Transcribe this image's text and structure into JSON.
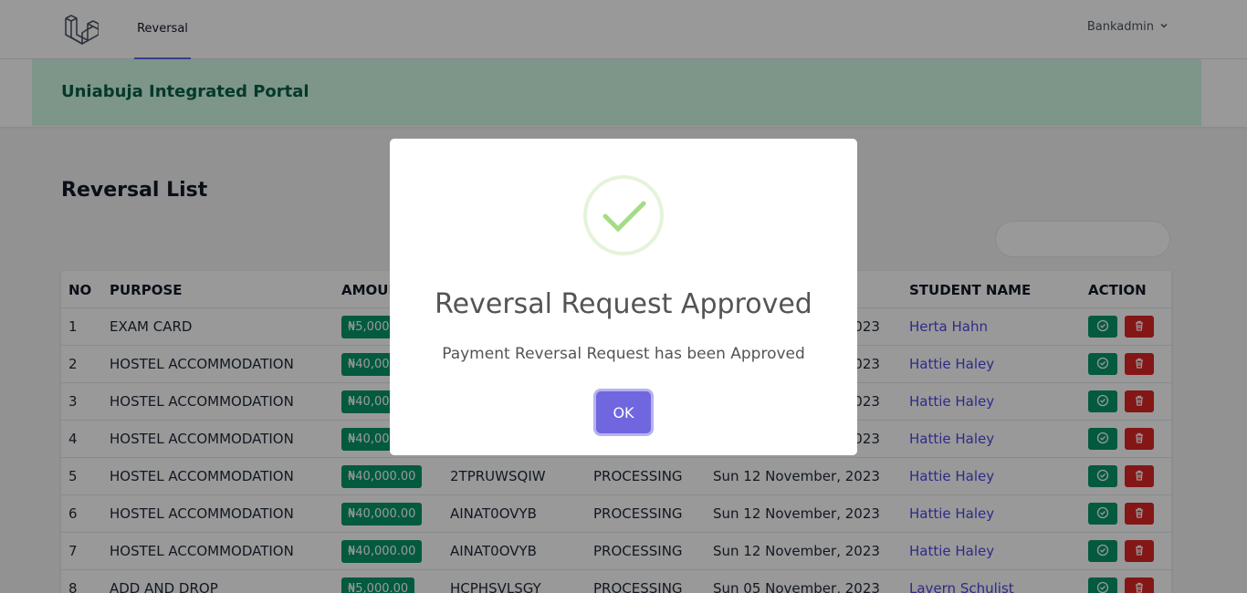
{
  "nav": {
    "link": "Reversal",
    "user": "Bankadmin"
  },
  "header": {
    "title": "Uniabuja Integrated Portal"
  },
  "page": {
    "title": "Reversal List"
  },
  "table": {
    "columns": [
      "NO",
      "PURPOSE",
      "AMOUNT",
      "",
      "",
      "",
      "STUDENT NAME",
      "ACTION"
    ],
    "rows": [
      {
        "no": "1",
        "purpose": "EXAM CARD",
        "amount": "₦5,000.00",
        "ref": "",
        "status": "",
        "date": "Sun 12 November, 2023",
        "student": "Herta Hahn"
      },
      {
        "no": "2",
        "purpose": "HOSTEL ACCOMMODATION",
        "amount": "₦40,000.00",
        "ref": "",
        "status": "",
        "date": "Sun 12 November, 2023",
        "student": "Hattie Haley"
      },
      {
        "no": "3",
        "purpose": "HOSTEL ACCOMMODATION",
        "amount": "₦40,000.00",
        "ref": "",
        "status": "",
        "date": "Sun 12 November, 2023",
        "student": "Hattie Haley"
      },
      {
        "no": "4",
        "purpose": "HOSTEL ACCOMMODATION",
        "amount": "₦40,000.00",
        "ref": "",
        "status": "",
        "date": "Sun 12 November, 2023",
        "student": "Hattie Haley"
      },
      {
        "no": "5",
        "purpose": "HOSTEL ACCOMMODATION",
        "amount": "₦40,000.00",
        "ref": "2TPRUWSQIW",
        "status": "PROCESSING",
        "date": "Sun 12 November, 2023",
        "student": "Hattie Haley"
      },
      {
        "no": "6",
        "purpose": "HOSTEL ACCOMMODATION",
        "amount": "₦40,000.00",
        "ref": "AINAT0OVYB",
        "status": "PROCESSING",
        "date": "Sun 12 November, 2023",
        "student": "Hattie Haley"
      },
      {
        "no": "7",
        "purpose": "HOSTEL ACCOMMODATION",
        "amount": "₦40,000.00",
        "ref": "AINAT0OVYB",
        "status": "PROCESSING",
        "date": "Sun 12 November, 2023",
        "student": "Hattie Haley"
      },
      {
        "no": "8",
        "purpose": "ADD AND DROP",
        "amount": "₦5,000.00",
        "ref": "HCPHSVLSGY",
        "status": "PROCESSING",
        "date": "Sun 05 November, 2023",
        "student": "Lavern Schulist"
      }
    ]
  },
  "modal": {
    "title": "Reversal Request Approved",
    "text": "Payment Reversal Request has been Approved",
    "ok_label": "OK"
  },
  "colors": {
    "accent": "#6366f1",
    "success": "#059669",
    "danger": "#dc2626",
    "confirm": "#7066e0"
  }
}
